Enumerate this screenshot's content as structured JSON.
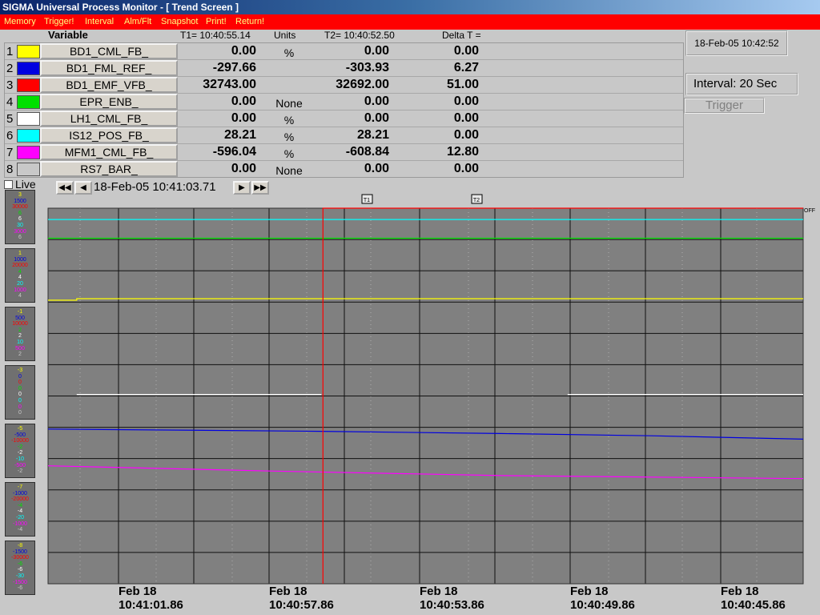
{
  "window": {
    "title": "SIGMA Universal Process Monitor - [ Trend Screen ]"
  },
  "menu": [
    "Memory",
    "Trigger!",
    "Interval",
    "Alm/Flt",
    "Snapshot",
    "Print!",
    "Return!"
  ],
  "header": {
    "variable": "Variable",
    "t1": "T1= 10:40:55.14",
    "units": "Units",
    "t2": "T2= 10:40:52.50",
    "delta": "Delta T ="
  },
  "variables": [
    {
      "num": "1",
      "color": "#ffff00",
      "name": "BD1_CML_FB_",
      "v1": "0.00",
      "unit": "%",
      "v2": "0.00",
      "delta": "0.00"
    },
    {
      "num": "2",
      "color": "#0000e0",
      "name": "BD1_FML_REF_",
      "v1": "-297.66",
      "unit": "",
      "v2": "-303.93",
      "delta": "6.27"
    },
    {
      "num": "3",
      "color": "#ff0000",
      "name": "BD1_EMF_VFB_",
      "v1": "32743.00",
      "unit": "",
      "v2": "32692.00",
      "delta": "51.00"
    },
    {
      "num": "4",
      "color": "#00e000",
      "name": "EPR_ENB_",
      "v1": "0.00",
      "unit": "None",
      "v2": "0.00",
      "delta": "0.00"
    },
    {
      "num": "5",
      "color": "#ffffff",
      "name": "LH1_CML_FB_",
      "v1": "0.00",
      "unit": "%",
      "v2": "0.00",
      "delta": "0.00"
    },
    {
      "num": "6",
      "color": "#00ffff",
      "name": "IS12_POS_FB_",
      "v1": "28.21",
      "unit": "%",
      "v2": "28.21",
      "delta": "0.00"
    },
    {
      "num": "7",
      "color": "#ff00ff",
      "name": "MFM1_CML_FB_",
      "v1": "-596.04",
      "unit": "%",
      "v2": "-608.84",
      "delta": "12.80"
    },
    {
      "num": "8",
      "color": "#c8c8c8",
      "name": "RS7_BAR_",
      "v1": "0.00",
      "unit": "None",
      "v2": "0.00",
      "delta": "0.00"
    }
  ],
  "status": {
    "datetime": "18-Feb-05 10:42:52",
    "interval": "Interval:  20 Sec",
    "trigger": "Trigger"
  },
  "nav": {
    "live": "Live",
    "date": "18-Feb-05 10:41:03.71",
    "first": "◀◀",
    "prev": "◀",
    "next": "▶",
    "last": "▶▶"
  },
  "cursor_markers": [
    "T1",
    "T2"
  ],
  "off_label": "OFF",
  "scale_colors": [
    "#ffff00",
    "#0000e0",
    "#ff0000",
    "#00e000",
    "#ffffff",
    "#00ffff",
    "#ff00ff",
    "#c8c8c8"
  ],
  "scales": [
    [
      "3",
      "1500",
      "30000",
      "6",
      "6",
      "30",
      "3000",
      "6"
    ],
    [
      "1",
      "1000",
      "20000",
      "4",
      "4",
      "20",
      "1000",
      "4"
    ],
    [
      "-1",
      "500",
      "10000",
      "2",
      "2",
      "10",
      "500",
      "2"
    ],
    [
      "-3",
      "0",
      "0",
      "0",
      "0",
      "0",
      "0",
      "0"
    ],
    [
      "-5",
      "-500",
      "-10000",
      "-2",
      "-2",
      "-10",
      "-500",
      "-2"
    ],
    [
      "-7",
      "-1000",
      "-20000",
      "-4",
      "-4",
      "-20",
      "-1000",
      "-4"
    ],
    [
      "-8",
      "-1500",
      "-30000",
      "-6",
      "-6",
      "-30",
      "-1500",
      "-6"
    ]
  ],
  "x_axis": [
    {
      "date": "Feb 18",
      "time": "10:41:01.86"
    },
    {
      "date": "Feb 18",
      "time": "10:40:57.86"
    },
    {
      "date": "Feb 18",
      "time": "10:40:53.86"
    },
    {
      "date": "Feb 18",
      "time": "10:40:49.86"
    },
    {
      "date": "Feb 18",
      "time": "10:40:45.86"
    }
  ],
  "chart_data": {
    "type": "line",
    "x_range_seconds_before_latest": [
      -17.86,
      0
    ],
    "y_range_percent_of_span": [
      0,
      100
    ],
    "grid": true,
    "series": [
      {
        "name": "IS12_POS_FB_",
        "color": "#00ffff",
        "points": [
          [
            0,
            97
          ],
          [
            100,
            97
          ]
        ]
      },
      {
        "name": "EPR_ENB_",
        "color": "#00e000",
        "points": [
          [
            0,
            92
          ],
          [
            100,
            92
          ]
        ]
      },
      {
        "name": "BD1_CML_FB_",
        "color": "#ffff00",
        "points": [
          [
            0,
            75.5
          ],
          [
            3.8,
            75.5
          ],
          [
            3.8,
            75.9
          ],
          [
            100,
            75.9
          ]
        ]
      },
      {
        "name": "LH1_CML_FB_",
        "color": "#ffffff",
        "points": [
          [
            3.8,
            50.4
          ],
          [
            36.2,
            50.4
          ]
        ],
        "extra_segments": [
          [
            [
              68.8,
              50.4
            ],
            [
              100,
              50.4
            ]
          ]
        ]
      },
      {
        "name": "BD1_FML_REF_",
        "color": "#0000e0",
        "points": [
          [
            0,
            41.2
          ],
          [
            36,
            40.6
          ],
          [
            60,
            40.0
          ],
          [
            80,
            39.4
          ],
          [
            100,
            38.5
          ]
        ]
      },
      {
        "name": "MFM1_CML_FB_",
        "color": "#ff00ff",
        "points": [
          [
            0,
            31.4
          ],
          [
            30,
            30.0
          ],
          [
            60,
            28.8
          ],
          [
            100,
            28.0
          ]
        ]
      },
      {
        "name": "BD1_EMF_VFB_",
        "color": "#ff0000",
        "points": [
          [
            36.4,
            0
          ],
          [
            36.4,
            100
          ],
          [
            100,
            100
          ]
        ]
      }
    ]
  }
}
